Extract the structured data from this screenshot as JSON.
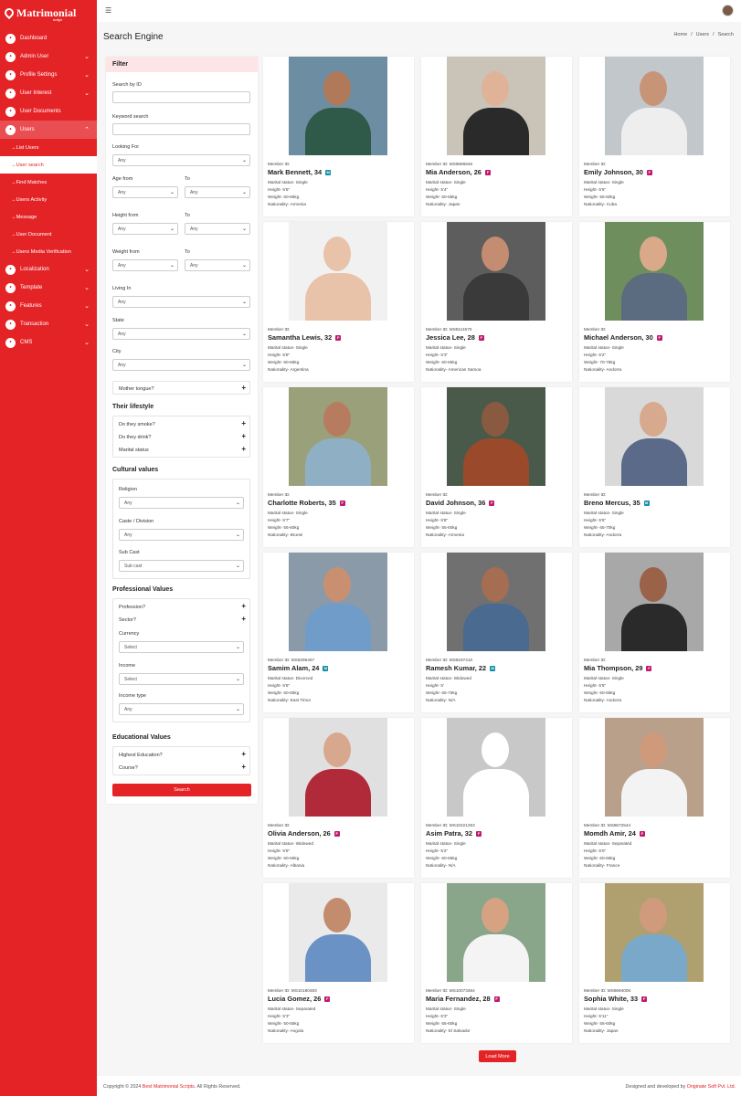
{
  "app": {
    "logo_text": "Matrimonial",
    "logo_sub": "script"
  },
  "sidebar": {
    "items": [
      {
        "label": "Dashboard",
        "icon": "dashboard-icon",
        "chevron": false
      },
      {
        "label": "Admin User",
        "icon": "user-icon",
        "chevron": true
      },
      {
        "label": "Profile Settings",
        "icon": "profile-icon",
        "chevron": true
      },
      {
        "label": "User Interest",
        "icon": "interest-icon",
        "chevron": true
      },
      {
        "label": "User Documents",
        "icon": "document-icon",
        "chevron": false
      },
      {
        "label": "Users",
        "icon": "users-icon",
        "chevron": true
      }
    ],
    "sub_items": [
      {
        "label": "List Users"
      },
      {
        "label": "User search"
      },
      {
        "label": "Find Matches"
      },
      {
        "label": "Users Activity"
      },
      {
        "label": "Message"
      },
      {
        "label": "User Document"
      },
      {
        "label": "Users Media Verification"
      }
    ],
    "items2": [
      {
        "label": "Localization",
        "icon": "globe-icon"
      },
      {
        "label": "Template",
        "icon": "template-icon"
      },
      {
        "label": "Features",
        "icon": "features-icon"
      },
      {
        "label": "Transaction",
        "icon": "transaction-icon"
      },
      {
        "label": "CMS",
        "icon": "cms-icon"
      }
    ]
  },
  "page": {
    "title": "Search Engine",
    "breadcrumb": [
      "Home",
      "/",
      "Users",
      "/",
      "Search"
    ]
  },
  "filter": {
    "title": "Filter",
    "search_by_id": "Search by ID",
    "keyword": "Keyword search",
    "looking_for": "Looking For",
    "any": "Any",
    "age_from": "Age from",
    "to": "To",
    "height_from": "Height from",
    "weight_from": "Weight from",
    "living_in": "Living In",
    "state": "State",
    "city": "City",
    "mother_tongue": "Mother tongue?",
    "lifestyle": "Their lifestyle",
    "smoke": "Do they smoke?",
    "drink": "Do they drink?",
    "marital": "Marital status",
    "cultural": "Cultural values",
    "religion": "Religion",
    "caste": "Caste / Division",
    "subcast": "Sub Cast",
    "subcast_ph": "Sub cast",
    "professional": "Professional Values",
    "profession": "Profession?",
    "sector": "Sector?",
    "currency": "Currency",
    "select": "Select",
    "income": "Income",
    "income_type": "Income type",
    "educational": "Educational Values",
    "highest_edu": "Highest Education?",
    "course": "Course?",
    "search_btn": "Search"
  },
  "colors": {
    "accent": "#e42327",
    "badge_female": "#c0196e",
    "badge_male": "#1590a8"
  },
  "profiles": [
    {
      "member": "Member ID:",
      "name": "Mark Bennett, 34",
      "gender": "M",
      "marital": "Marital status- Single",
      "height": "Height- 5'6\"",
      "weight": "Weight- 60-65kg",
      "nationality": "Nationality- Armenia",
      "skin": "#b07a5a",
      "shirt": "#2f5a4a",
      "bg": "#6d8ea2"
    },
    {
      "member": "Member ID: MS9686846",
      "name": "Mia Anderson, 26",
      "gender": "F",
      "marital": "Marital status- Single",
      "height": "Height- 5'4\"",
      "weight": "Weight- 50-55kg",
      "nationality": "Nationality- Japan",
      "skin": "#e0b398",
      "shirt": "#2a2a2a",
      "bg": "#c9c3b8"
    },
    {
      "member": "Member ID:",
      "name": "Emily Johnson, 30",
      "gender": "F",
      "marital": "Marital status- Single",
      "height": "Height- 5'6\"",
      "weight": "Weight- 55-60kg",
      "nationality": "Nationality- Cuba",
      "skin": "#c89478",
      "shirt": "#eeeeee",
      "bg": "#c2c7cc"
    },
    {
      "member": "Member ID:",
      "name": "Samantha Lewis, 32",
      "gender": "F",
      "marital": "Marital status- Single",
      "height": "Height- 5'8\"",
      "weight": "Weight- 60-65kg",
      "nationality": "Nationality- Argentina",
      "skin": "#e9c2aa",
      "shirt": "#e9c2aa",
      "bg": "#f1f1f1"
    },
    {
      "member": "Member ID: MS8111570",
      "name": "Jessica Lee, 28",
      "gender": "F",
      "marital": "Marital status- Single",
      "height": "Height- 5'3\"",
      "weight": "Weight- 60-65kg",
      "nationality": "Nationality- American Samoa",
      "skin": "#c48d72",
      "shirt": "#3a3a3a",
      "bg": "#5d5d5d"
    },
    {
      "member": "Member ID:",
      "name": "Michael Anderson, 30",
      "gender": "F",
      "marital": "Marital status- Single",
      "height": "Height- 6'2\"",
      "weight": "Weight- 70-75kg",
      "nationality": "Nationality- Andorra",
      "skin": "#d9a98a",
      "shirt": "#5b6b80",
      "bg": "#6f8e5e"
    },
    {
      "member": "Member ID:",
      "name": "Charlotte Roberts, 35",
      "gender": "F",
      "marital": "Marital status- Single",
      "height": "Height- 5'7\"",
      "weight": "Weight- 55-60kg",
      "nationality": "Nationality- Brunei",
      "skin": "#b77c60",
      "shirt": "#8fb0c4",
      "bg": "#9aa07a"
    },
    {
      "member": "Member ID:",
      "name": "David Johnson, 36",
      "gender": "F",
      "marital": "Marital status- Single",
      "height": "Height- 5'8\"",
      "weight": "Weight- 55-60kg",
      "nationality": "Nationality- Armenia",
      "skin": "#8a5a40",
      "shirt": "#9a4a2a",
      "bg": "#4a5a4a"
    },
    {
      "member": "Member ID:",
      "name": "Breno Mercus, 35",
      "gender": "M",
      "marital": "Marital status- Single",
      "height": "Height- 5'5\"",
      "weight": "Weight- 65-70kg",
      "nationality": "Nationality- Andorra",
      "skin": "#d7a98e",
      "shirt": "#5a6a88",
      "bg": "#d9d9d9"
    },
    {
      "member": "Member ID: MS6296467",
      "name": "Samim Alam, 24",
      "gender": "M",
      "marital": "Marital status- Divorced",
      "height": "Height- 5'6\"",
      "weight": "Weight- 60-65kg",
      "nationality": "Nationality- East Timor",
      "skin": "#c89070",
      "shirt": "#6f9cc8",
      "bg": "#8a9aa8"
    },
    {
      "member": "Member ID: MS8197410",
      "name": "Ramesh Kumar, 22",
      "gender": "M",
      "marital": "Marital status- Widowed",
      "height": "Height- 5'",
      "weight": "Weight- 65-70kg",
      "nationality": "Nationality- N/A",
      "skin": "#a56d52",
      "shirt": "#4a6a90",
      "bg": "#707070"
    },
    {
      "member": "Member ID:",
      "name": "Mia Thompson, 29",
      "gender": "F",
      "marital": "Marital status- Single",
      "height": "Height- 5'5\"",
      "weight": "Weight- 60-65kg",
      "nationality": "Nationality- Andorra",
      "skin": "#9a6248",
      "shirt": "#2a2a2a",
      "bg": "#a8a8a8"
    },
    {
      "member": "Member ID:",
      "name": "Olivia Anderson, 26",
      "gender": "F",
      "marital": "Marital status- Widowed",
      "height": "Height- 5'6\"",
      "weight": "Weight- 60-65kg",
      "nationality": "Nationality- Albania",
      "skin": "#d8a88e",
      "shirt": "#b02a3a",
      "bg": "#e0e0e0"
    },
    {
      "member": "Member ID: MS10221253",
      "name": "Asim Patra, 32",
      "gender": "F",
      "marital": "Marital status- Single",
      "height": "Height- 5'2\"",
      "weight": "Weight- 60-65kg",
      "nationality": "Nationality- N/A",
      "skin": "#ffffff",
      "shirt": "#ffffff",
      "bg": "#c8c8c8"
    },
    {
      "member": "Member ID: MS8672544",
      "name": "Momdh Amir, 24",
      "gender": "F",
      "marital": "Marital status- Separated",
      "height": "Height- 6'0\"",
      "weight": "Weight- 60-65kg",
      "nationality": "Nationality- France",
      "skin": "#cf9a7c",
      "shirt": "#f3f3f3",
      "bg": "#b8a08a"
    },
    {
      "member": "Member ID: MS10180483",
      "name": "Lucia Gomez, 26",
      "gender": "F",
      "marital": "Marital status- Separated",
      "height": "Height- 5'3\"",
      "weight": "Weight- 50-55kg",
      "nationality": "Nationality- Angola",
      "skin": "#c48c6e",
      "shirt": "#6a92c4",
      "bg": "#eaeaea"
    },
    {
      "member": "Member ID: MS10073464",
      "name": "Maria Fernandez, 28",
      "gender": "F",
      "marital": "Marital status- Single",
      "height": "Height- 5'3\"",
      "weight": "Weight- 55-60kg",
      "nationality": "Nationality- El Salvador",
      "skin": "#d6a282",
      "shirt": "#f4f4f4",
      "bg": "#8aa68a"
    },
    {
      "member": "Member ID: MS9694006",
      "name": "Sophia White, 33",
      "gender": "F",
      "marital": "Marital status- Single",
      "height": "Height- 5'11\"",
      "weight": "Weight- 55-60kg",
      "nationality": "Nationality- Japan",
      "skin": "#d09a7c",
      "shirt": "#7aa8c8",
      "bg": "#b0a070"
    }
  ],
  "load_more": "Load More",
  "footer": {
    "left_pre": "Copyright © 2024 ",
    "left_link": "Best Matrimonial Scripts",
    "left_post": ". All Rights Reserved.",
    "right_pre": "Designed and developed by ",
    "right_link": "Originate Soft Pvt. Ltd."
  }
}
